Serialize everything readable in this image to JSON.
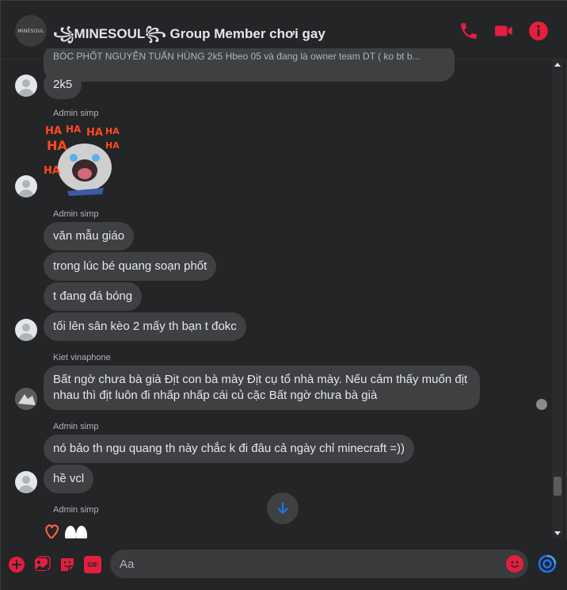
{
  "header": {
    "title": "꧁MINESOUL꧂ Group Member chơi gay",
    "avatar_text": "MINESOUL",
    "icons": [
      "phone-icon",
      "video-camera-icon",
      "info-icon"
    ]
  },
  "messages": {
    "truncated_preview": "BÓC PHỐT NGUYỄN TUẤN HÙNG 2k5 Hbeo 05 và đang là owner team DT ( ko bt b...",
    "m1": "2k5",
    "sender1": "Admin simp",
    "sender2": "Admin simp",
    "m2": "văn mẫu giáo",
    "m3": "trong lúc bé quang soạn phốt",
    "m4": "t đang đá bóng",
    "m5": "tối lên sân kèo 2 mấy th bạn t đokc",
    "sender3": "Kiet vinaphone",
    "m6": "Bất ngờ chưa bà già Địt con bà mày  Địt cụ tổ nhà mày. Nếu cảm thấy muốn địt nhau thì địt luôn đi nhấp nhấp cái củ cặc Bất ngờ chưa bà già",
    "sender4": "Admin simp",
    "m7": "nó bảo th ngu quang th này chắc k đi đâu cả ngày chỉ minecraft =))",
    "m8": "hề vcl",
    "sender5": "Admin simp"
  },
  "composer": {
    "placeholder": "Aa",
    "tools": [
      "add-icon",
      "image-icon",
      "sticker-icon",
      "gif-icon"
    ],
    "gif_label": "GIF"
  },
  "colors": {
    "accent": "#e41e3f",
    "bubble": "#3e4042",
    "background": "#242526"
  }
}
